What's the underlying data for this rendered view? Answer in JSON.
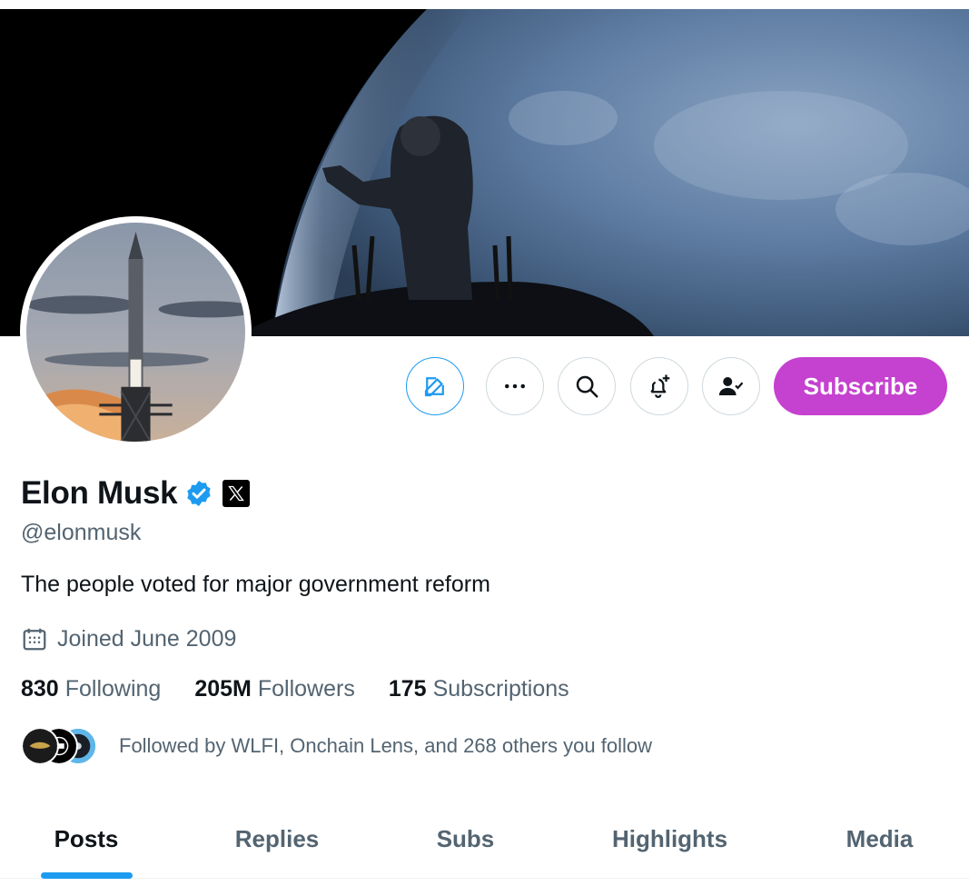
{
  "profile": {
    "name": "Elon Musk",
    "handle": "@elonmusk",
    "bio": "The people voted for major government reform",
    "joined": "Joined June 2009"
  },
  "actions": {
    "subscribe_label": "Subscribe"
  },
  "stats": [
    {
      "value": "830",
      "label": "Following"
    },
    {
      "value": "205M",
      "label": "Followers"
    },
    {
      "value": "175",
      "label": "Subscriptions"
    }
  ],
  "followed_by": "Followed by WLFI, Onchain Lens, and 268 others you follow",
  "tabs": [
    {
      "label": "Posts",
      "active": true
    },
    {
      "label": "Replies",
      "active": false
    },
    {
      "label": "Subs",
      "active": false
    },
    {
      "label": "Highlights",
      "active": false
    },
    {
      "label": "Media",
      "active": false
    }
  ],
  "icons": {
    "edit": "edit-icon",
    "more": "more-icon",
    "search": "search-icon",
    "notify": "bell-plus-icon",
    "following": "user-check-icon",
    "verified": "verified-badge-icon",
    "x_affiliate": "x-logo-icon",
    "calendar": "calendar-icon"
  },
  "colors": {
    "accent": "#1d9bf0",
    "subscribe": "#c541cf",
    "text_primary": "#0f1419",
    "text_secondary": "#536471"
  }
}
